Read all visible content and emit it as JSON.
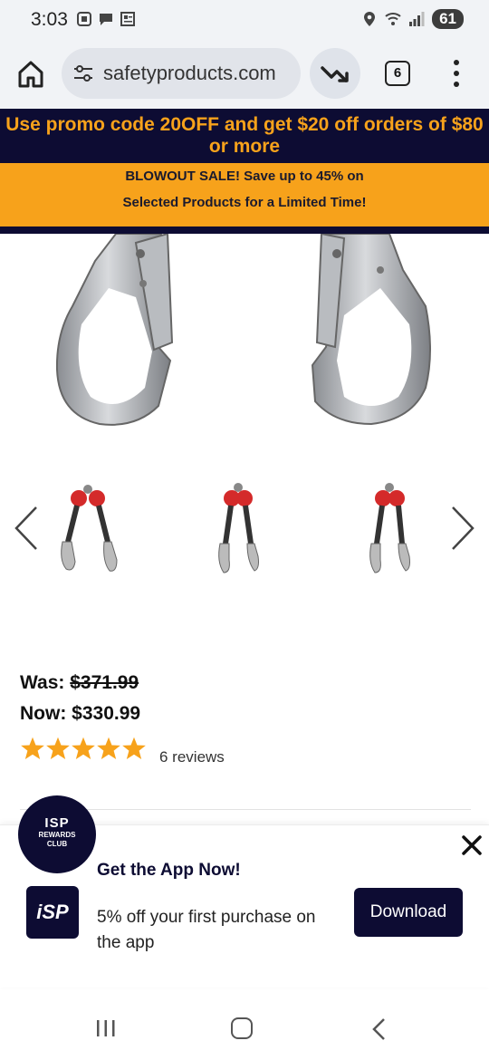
{
  "status_bar": {
    "time": "3:03",
    "battery": "61",
    "icons_left": [
      "screenshot-icon",
      "chat-icon",
      "news-icon"
    ],
    "icons_right": [
      "location-icon",
      "wifi-icon",
      "signal-icon"
    ]
  },
  "browser": {
    "url": "safetyproducts.com",
    "tab_count": "6",
    "icons": [
      "home-icon",
      "site-settings-icon",
      "trending-down-icon",
      "tabs-icon",
      "more-vert-icon"
    ]
  },
  "promo": {
    "line1": "Use promo code 20OFF and get $20 off orders of $80 or more",
    "line2a": "BLOWOUT SALE! Save up to 45% on",
    "line2b": "Selected Products for a Limited Time!",
    "colors": {
      "dark": "#0d0c33",
      "orange": "#f7a21b"
    }
  },
  "product": {
    "was_label": "Was:",
    "was_price": "$371.99",
    "now_label": "Now:",
    "now_price": "$330.99",
    "rating": 5,
    "reviews": "6 reviews",
    "thumbnail_count": 3
  },
  "app_banner": {
    "badge_title": "ISP",
    "badge_sub1": "REWARDS",
    "badge_sub2": "CLUB",
    "logo_text": "iSP",
    "title": "Get the App Now!",
    "description": "5% off your first purchase on the app",
    "download_label": "Download"
  },
  "nav": {
    "icons": [
      "recent-apps-icon",
      "home-circle-icon",
      "back-icon"
    ]
  }
}
